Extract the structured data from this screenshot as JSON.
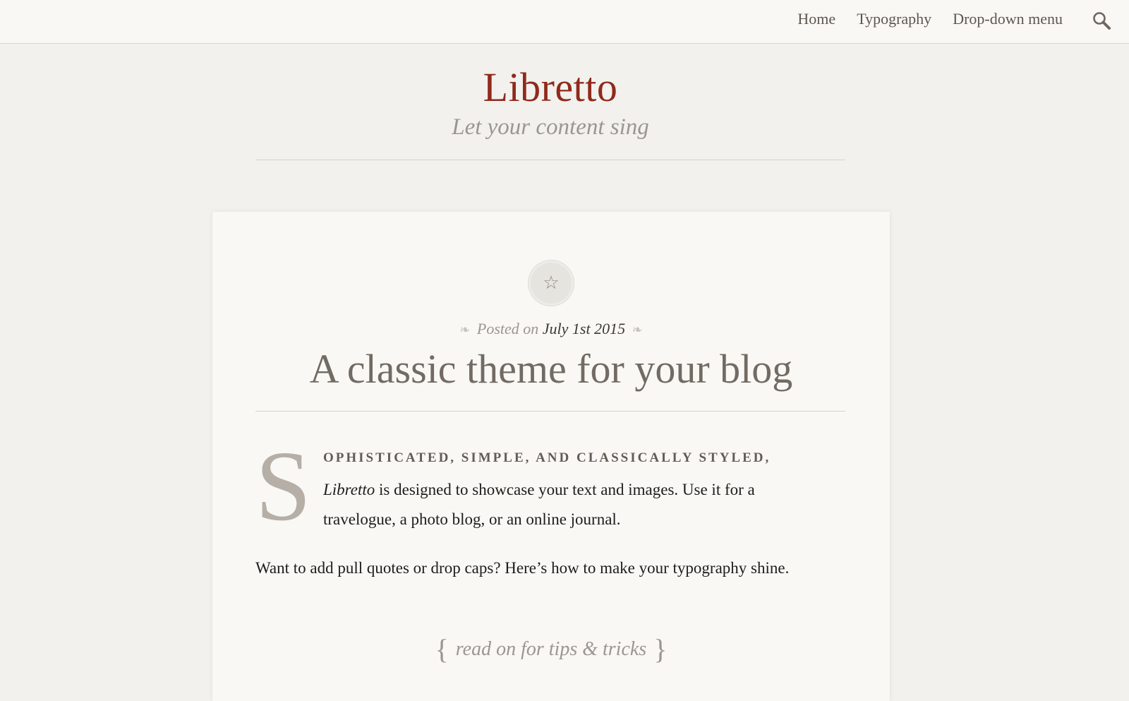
{
  "nav": {
    "items": [
      {
        "label": "Home"
      },
      {
        "label": "Typography"
      },
      {
        "label": "Drop-down menu"
      }
    ]
  },
  "site": {
    "title": "Libretto",
    "tagline": "Let your content sing"
  },
  "post": {
    "badge_symbol": "☆",
    "meta_prefix": "Posted on",
    "date": "July 1st 2015",
    "title": "A classic theme for your blog",
    "dropcap": "S",
    "intro_caps": "OPHISTICATED, SIMPLE, AND CLASSICALLY STYLED,",
    "intro_em": "Libretto",
    "intro_rest": " is designed to showcase your text and images. Use it for a travelogue, a photo blog, or an online journal.",
    "paragraph2": "Want to add pull quotes or drop caps? Here’s how to make your typography shine.",
    "read_more": "read on for tips & tricks"
  },
  "icons": {
    "search": "search-icon",
    "badge": "star-icon"
  },
  "colors": {
    "title": "#8f2a1c",
    "background": "#f2f1ee",
    "card": "#f9f8f5"
  }
}
